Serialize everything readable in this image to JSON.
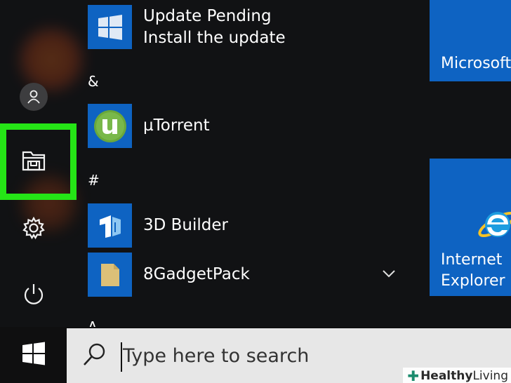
{
  "start_menu": {
    "apps": [
      {
        "label_line1": "Update Pending",
        "label_line2": "Install the update",
        "icon": "windows-logo-icon"
      },
      {
        "label": "µTorrent",
        "icon": "utorrent-icon"
      },
      {
        "label": "3D Builder",
        "icon": "3d-builder-icon"
      },
      {
        "label": "8GadgetPack",
        "icon": "folder-icon"
      }
    ],
    "sections": [
      "&",
      "#",
      "A"
    ],
    "rail": [
      "user-icon",
      "file-explorer-icon",
      "settings-gear-icon",
      "power-icon"
    ],
    "highlight_color": "#25e516"
  },
  "tiles": [
    {
      "label": "Microsoft"
    },
    {
      "label_line1": "Internet",
      "label_line2": "Explorer",
      "icon": "internet-explorer-icon"
    }
  ],
  "taskbar": {
    "search_placeholder": "Type here to search",
    "start_icon": "windows-logo-icon"
  },
  "watermark": {
    "prefix": "Healthy",
    "suffix": " Living"
  },
  "colors": {
    "tile_blue": "#0e63c2",
    "background": "#111214",
    "search_bg": "#e7e7e7"
  }
}
